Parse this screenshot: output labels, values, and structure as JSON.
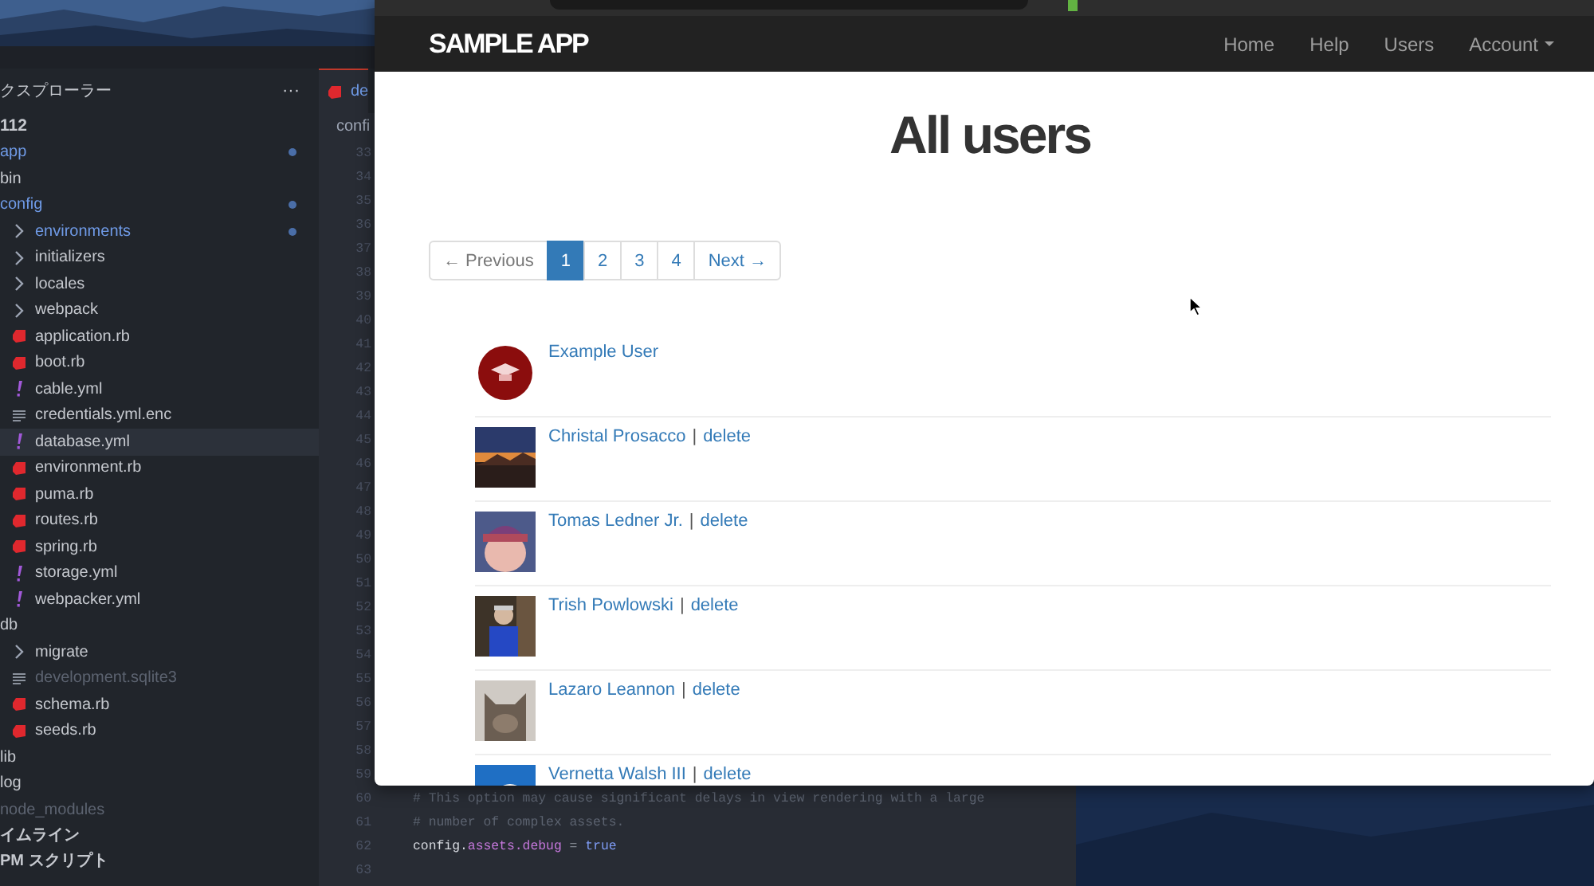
{
  "explorer": {
    "title": "クスプローラー",
    "more": "···",
    "root": "112",
    "items": [
      {
        "name": "app",
        "modified": true,
        "dimmed": false,
        "selected": false
      },
      {
        "name": "bin",
        "modified": false,
        "dimmed": false,
        "selected": false
      },
      {
        "name": "config",
        "modified": true,
        "dimmed": false,
        "selected": false,
        "children": [
          {
            "name": "environments",
            "kind": "folder",
            "modified": true,
            "dimmed": false,
            "selected": false
          },
          {
            "name": "initializers",
            "kind": "folder",
            "modified": false,
            "dimmed": false,
            "selected": false
          },
          {
            "name": "locales",
            "kind": "folder",
            "modified": false,
            "dimmed": false,
            "selected": false
          },
          {
            "name": "webpack",
            "kind": "folder",
            "modified": false,
            "dimmed": false,
            "selected": false
          },
          {
            "name": "application.rb",
            "kind": "ruby",
            "modified": false,
            "dimmed": false,
            "selected": false
          },
          {
            "name": "boot.rb",
            "kind": "ruby",
            "modified": false,
            "dimmed": false,
            "selected": false
          },
          {
            "name": "cable.yml",
            "kind": "yaml",
            "modified": false,
            "dimmed": false,
            "selected": false
          },
          {
            "name": "credentials.yml.enc",
            "kind": "text",
            "modified": false,
            "dimmed": false,
            "selected": false
          },
          {
            "name": "database.yml",
            "kind": "yaml",
            "modified": false,
            "dimmed": false,
            "selected": true
          },
          {
            "name": "environment.rb",
            "kind": "ruby",
            "modified": false,
            "dimmed": false,
            "selected": false
          },
          {
            "name": "puma.rb",
            "kind": "ruby",
            "modified": false,
            "dimmed": false,
            "selected": false
          },
          {
            "name": "routes.rb",
            "kind": "ruby",
            "modified": false,
            "dimmed": false,
            "selected": false
          },
          {
            "name": "spring.rb",
            "kind": "ruby",
            "modified": false,
            "dimmed": false,
            "selected": false
          },
          {
            "name": "storage.yml",
            "kind": "yaml",
            "modified": false,
            "dimmed": false,
            "selected": false
          },
          {
            "name": "webpacker.yml",
            "kind": "yaml",
            "modified": false,
            "dimmed": false,
            "selected": false
          }
        ]
      },
      {
        "name": "db",
        "modified": false,
        "dimmed": false,
        "selected": false,
        "children": [
          {
            "name": "migrate",
            "kind": "folder",
            "modified": false,
            "dimmed": false,
            "selected": false
          },
          {
            "name": "development.sqlite3",
            "kind": "text",
            "modified": false,
            "dimmed": true,
            "selected": false
          },
          {
            "name": "schema.rb",
            "kind": "ruby",
            "modified": false,
            "dimmed": false,
            "selected": false
          },
          {
            "name": "seeds.rb",
            "kind": "ruby",
            "modified": false,
            "dimmed": false,
            "selected": false
          }
        ]
      },
      {
        "name": "lib",
        "modified": false,
        "dimmed": false,
        "selected": false
      },
      {
        "name": "log",
        "modified": false,
        "dimmed": false,
        "selected": false
      },
      {
        "name": "node_modules",
        "modified": false,
        "dimmed": true,
        "selected": false
      }
    ],
    "sections": [
      "イムライン",
      "PM スクリプト"
    ]
  },
  "editor": {
    "tab": "de",
    "breadcrumb": "confi",
    "lines": [
      {
        "number": "33"
      },
      {
        "number": "34"
      },
      {
        "number": "35"
      },
      {
        "number": "36"
      },
      {
        "number": "37"
      },
      {
        "number": "38"
      },
      {
        "number": "39"
      },
      {
        "number": "40"
      },
      {
        "number": "41"
      },
      {
        "number": "42"
      },
      {
        "number": "43"
      },
      {
        "number": "44"
      },
      {
        "number": "45"
      },
      {
        "number": "46"
      },
      {
        "number": "47"
      },
      {
        "number": "48"
      },
      {
        "number": "49"
      },
      {
        "number": "50"
      },
      {
        "number": "51"
      },
      {
        "number": "52"
      },
      {
        "number": "53"
      },
      {
        "number": "54"
      },
      {
        "number": "55"
      },
      {
        "number": "56"
      },
      {
        "number": "57"
      },
      {
        "number": "58"
      },
      {
        "number": "59"
      },
      {
        "number": "60",
        "tokens": [
          {
            "text": "# This option may cause significant delays in view rendering with a large",
            "kind": "comment"
          }
        ]
      },
      {
        "number": "61",
        "tokens": [
          {
            "text": "# number of complex assets.",
            "kind": "comment"
          }
        ]
      },
      {
        "number": "62",
        "tokens": [
          {
            "text": "config.",
            "kind": "plain"
          },
          {
            "text": "assets.debug",
            "kind": "property"
          },
          {
            "text": " = ",
            "kind": "operator"
          },
          {
            "text": "true",
            "kind": "keyword"
          }
        ]
      },
      {
        "number": "63"
      }
    ]
  },
  "browser": {
    "brand": "SAMPLE APP",
    "nav": [
      {
        "label": "Home",
        "dropdown": false
      },
      {
        "label": "Help",
        "dropdown": false
      },
      {
        "label": "Users",
        "dropdown": false
      },
      {
        "label": "Account",
        "dropdown": true
      }
    ],
    "heading": "All users",
    "pagination": [
      {
        "label": "← Previous",
        "selected": false,
        "disabled": true
      },
      {
        "label": "1",
        "selected": true,
        "disabled": false
      },
      {
        "label": "2",
        "selected": false,
        "disabled": false
      },
      {
        "label": "3",
        "selected": false,
        "disabled": false
      },
      {
        "label": "4",
        "selected": false,
        "disabled": false
      },
      {
        "label": "Next →",
        "selected": false,
        "disabled": false
      }
    ],
    "users": [
      {
        "name": "Example User"
      },
      {
        "name": "Christal Prosacco",
        "separator": "|",
        "delete": "delete"
      },
      {
        "name": "Tomas Ledner Jr.",
        "separator": "|",
        "delete": "delete"
      },
      {
        "name": "Trish Powlowski",
        "separator": "|",
        "delete": "delete"
      },
      {
        "name": "Lazaro Leannon",
        "separator": "|",
        "delete": "delete"
      },
      {
        "name": "Vernetta Walsh III",
        "separator": "|",
        "delete": "delete"
      }
    ]
  }
}
